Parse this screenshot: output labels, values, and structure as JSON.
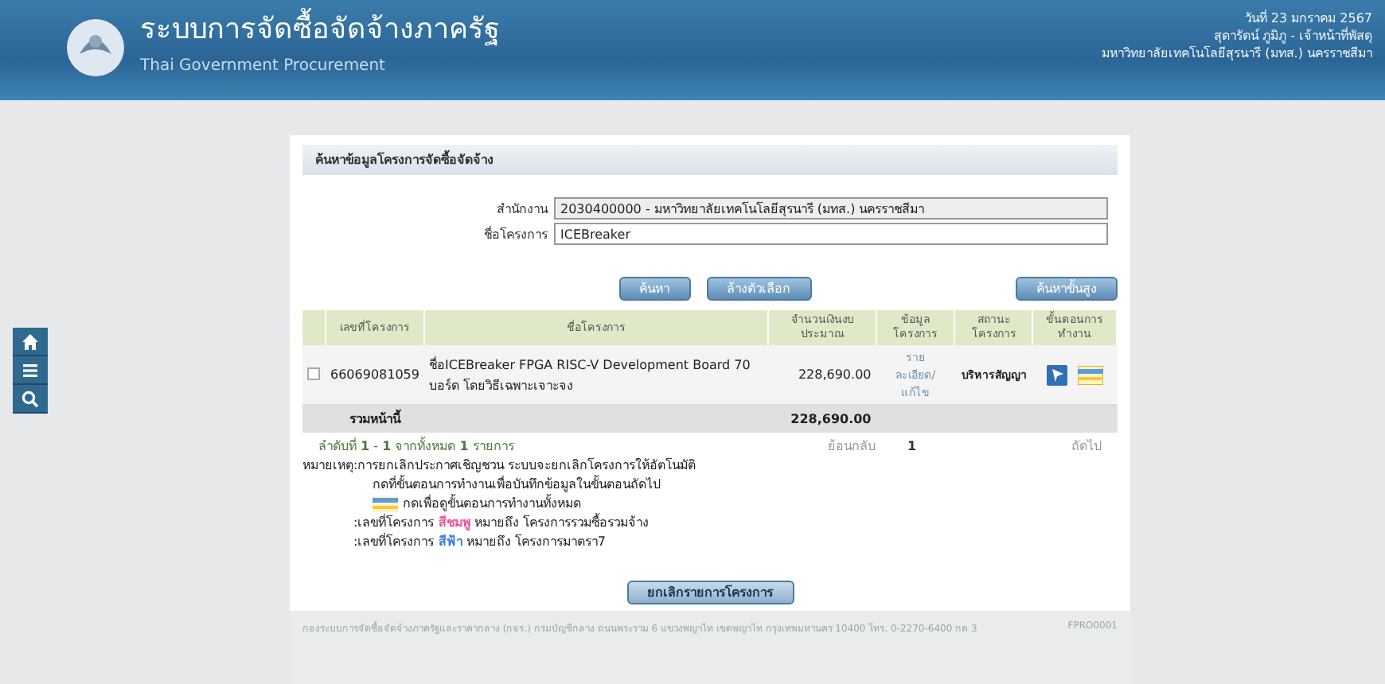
{
  "header": {
    "title": "ระบบการจัดซื้อจัดจ้างภาครัฐ",
    "subtitle": "Thai Government Procurement",
    "date": "วันที่ 23 มกราคม 2567",
    "user": "สุดารัตน์ ภูมิภู - เจ้าหน้าที่พัสดุ",
    "agency": "มหาวิทยาลัยเทคโนโลยีสุรนารี (มทส.) นครราชสีมา"
  },
  "side_tools": [
    {
      "kind": "home"
    },
    {
      "kind": "menu"
    },
    {
      "kind": "search"
    }
  ],
  "panel": {
    "title": "ค้นหาข้อมูลโครงการจัดซื้อจัดจ้าง"
  },
  "form": [
    {
      "label": "สำนักงาน",
      "value": "2030400000 - มหาวิทยาลัยเทคโนโลยีสุรนารี (มทส.) นครราชสีมา",
      "disabled": true
    },
    {
      "label": "ชื่อโครงการ",
      "value": "ICEBreaker",
      "disabled": false
    }
  ],
  "buttons": [
    "ค้นหา",
    "ล้างตัวเลือก"
  ],
  "advanced_button": "ค้นหาขั้นสูง",
  "table": {
    "columns": [
      "เลขที่โครงการ",
      "ชื่อโครงการ",
      "จำนวนเงินงบประมาณ",
      "ข้อมูลโครงการ",
      "สถานะโครงการ",
      "ขั้นตอนการทำงาน"
    ],
    "rows": [
      {
        "checked": false,
        "number": "66069081059",
        "name": "ชื่อICEBreaker FPGA RISC-V Development Board 70 บอร์ด โดยวิธีเฉพาะเจาะจง",
        "amount": "228,690.00",
        "link": "รายละเอียด/แก้ไข",
        "status": "บริหารสัญญา"
      }
    ],
    "total_label": "รวมหน้านี้",
    "total": "228,690.00"
  },
  "pagination": {
    "summary": "ลำดับที่ **1** - **1** จากทั้งหมด **1** รายการ",
    "prev": "ย้อนกลับ",
    "page": "1",
    "next": "ถัดไป"
  },
  "notes_label": "หมายเหตุ",
  "notes": [
    {
      "kind": "text",
      "text": ":การยกเลิกประกาศเชิญชวน ระบบจะยกเลิกโครงการให้อัตโนมัติ"
    },
    {
      "kind": "indent",
      "text": "กดที่ขั้นตอนการทำงานเพื่อบันทึกข้อมูลในขั้นตอนถัดไป"
    },
    {
      "kind": "icon",
      "text": "กดเพื่อดูขั้นตอนการทำงานทั้งหมด"
    },
    {
      "kind": "color",
      "before": ":เลขที่โครงการ",
      "word": "สีชมพู",
      "color": "#e8559a",
      "after": "หมายถึง โครงการรวมซื้อรวมจ้าง"
    },
    {
      "kind": "color",
      "before": ":เลขที่โครงการ",
      "word": "สีฟ้า",
      "color": "#3a7de0",
      "after": "หมายถึง โครงการมาตรา7"
    }
  ],
  "cancel_button": "ยกเลิกรายการโครงการ",
  "footer": {
    "address": "กองระบบการจัดซื้อจัดจ้างภาครัฐและราคากลาง (กจร.) กรมบัญชีกลาง ถนนพระราม 6 แขวงพญาไท เขตพญาไท กรุงเทพมหานคร 10400 โทร. 0-2270-6400 กด 3",
    "code": "FPRO0001"
  }
}
